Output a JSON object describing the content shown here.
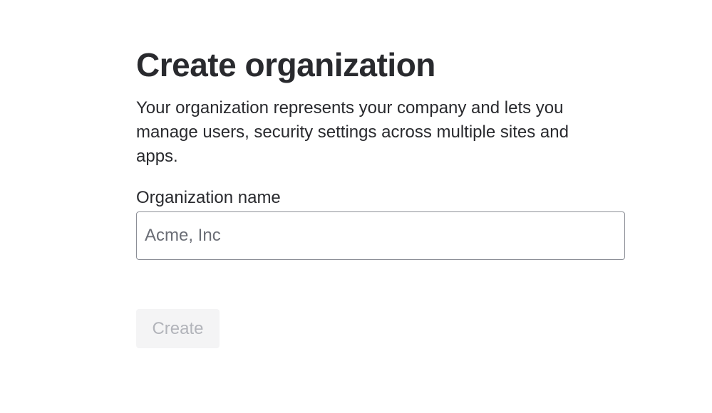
{
  "page": {
    "title": "Create organization",
    "description": "Your organization represents your company and lets you manage users, security settings across multiple sites and apps."
  },
  "form": {
    "org_name_label": "Organization name",
    "org_name_value": "",
    "org_name_placeholder": "Acme, Inc",
    "submit_label": "Create",
    "submit_disabled": true
  },
  "colors": {
    "text": "#292a2e",
    "input_border": "#8c8f97",
    "placeholder": "#6b6e76",
    "disabled_button_bg": "#f4f4f5",
    "disabled_button_text": "#b2b4ba"
  }
}
